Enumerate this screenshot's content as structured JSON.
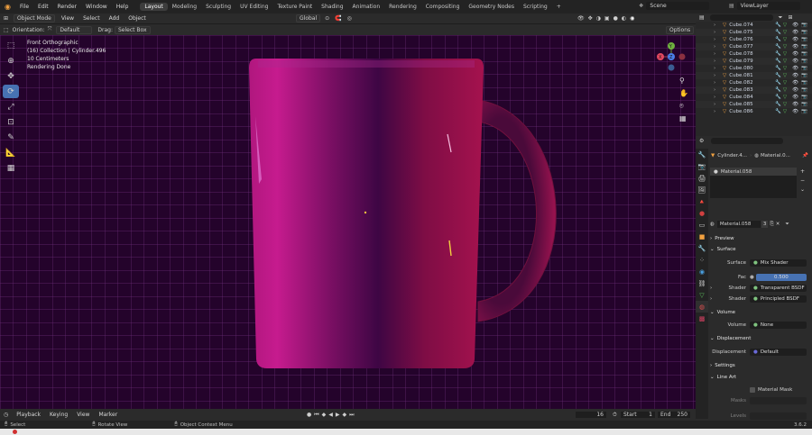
{
  "colors": {
    "accent": "#4772b3",
    "viewport_bg": "#24032b",
    "grid": "#7a3c88",
    "mug": "#b0126c",
    "material_dot": "#7fc47f"
  },
  "topbar": {
    "menus": [
      "File",
      "Edit",
      "Render",
      "Window",
      "Help"
    ],
    "workspaces": [
      "Layout",
      "Modeling",
      "Sculpting",
      "UV Editing",
      "Texture Paint",
      "Shading",
      "Animation",
      "Rendering",
      "Compositing",
      "Geometry Nodes",
      "Scripting"
    ],
    "active_workspace": "Layout",
    "add_tab": "+",
    "scene": "Scene",
    "view_layer": "ViewLayer"
  },
  "header": {
    "mode": "Object Mode",
    "menus": [
      "View",
      "Select",
      "Add",
      "Object"
    ],
    "transform": "Global"
  },
  "header2": {
    "orientation_label": "Orientation:",
    "orientation_value": "Default",
    "drag_label": "Drag:",
    "drag_value": "Select Box",
    "options": "Options"
  },
  "viewport": {
    "view_name": "Front Orthographic",
    "collection_info": "(16) Collection | Cylinder.496",
    "scale": "10 Centimeters",
    "status": "Rendering Done",
    "gizmo": {
      "x": "X",
      "y": "Y",
      "z": "Z"
    }
  },
  "outliner": {
    "items": [
      "Cube.074",
      "Cube.075",
      "Cube.076",
      "Cube.077",
      "Cube.078",
      "Cube.079",
      "Cube.080",
      "Cube.081",
      "Cube.082",
      "Cube.083",
      "Cube.084",
      "Cube.085",
      "Cube.086"
    ]
  },
  "properties": {
    "breadcrumb_object": "Cylinder.4...",
    "breadcrumb_material": "Material.0...",
    "slot": "Material.058",
    "material_name": "Material.058",
    "users": "3",
    "sections": {
      "preview": "Preview",
      "surface": "Surface",
      "volume": "Volume",
      "displacement": "Displacement",
      "settings": "Settings",
      "line_art": "Line Art"
    },
    "surface_label": "Surface",
    "surface_value": "Mix Shader",
    "fac_label": "Fac",
    "fac_value": "0.500",
    "shader1_label": "Shader",
    "shader1_value": "Transparent BSDF",
    "shader2_label": "Shader",
    "shader2_value": "Principled BSDF",
    "volume_label": "Volume",
    "volume_value": "None",
    "displacement_label": "Displacement",
    "displacement_value": "Default",
    "material_mask": "Material Mask",
    "masks": "Masks",
    "levels": "Levels"
  },
  "timeline": {
    "playback": "Playback",
    "keying": "Keying",
    "view": "View",
    "marker": "Marker",
    "current_frame": "16",
    "start_label": "Start",
    "start_value": "1",
    "end_label": "End",
    "end_value": "250"
  },
  "statusbar": {
    "select": "Select",
    "rotate": "Rotate View",
    "context": "Object Context Menu",
    "version": "3.6.2"
  }
}
